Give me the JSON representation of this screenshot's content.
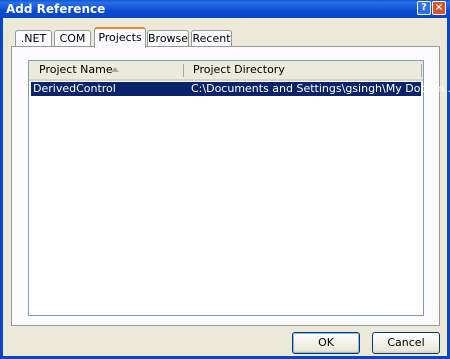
{
  "window": {
    "title": "Add Reference"
  },
  "titlebar_buttons": {
    "help": "?",
    "close": "×"
  },
  "tabs": [
    {
      "label": ".NET",
      "selected": false
    },
    {
      "label": "COM",
      "selected": false
    },
    {
      "label": "Projects",
      "selected": true
    },
    {
      "label": "Browse",
      "selected": false
    },
    {
      "label": "Recent",
      "selected": false
    }
  ],
  "list": {
    "columns": [
      {
        "label": "Project Name",
        "sorted": "ascending"
      },
      {
        "label": "Project Directory"
      }
    ],
    "rows": [
      {
        "name": "DerivedControl",
        "directory": "C:\\Documents and Settings\\gsingh\\My Docum...",
        "selected": true
      }
    ]
  },
  "buttons": {
    "ok": "OK",
    "cancel": "Cancel"
  },
  "colors": {
    "titlebar": "#0a4bd0",
    "selection": "#0a246a",
    "dialog_bg": "#ece9d8"
  }
}
